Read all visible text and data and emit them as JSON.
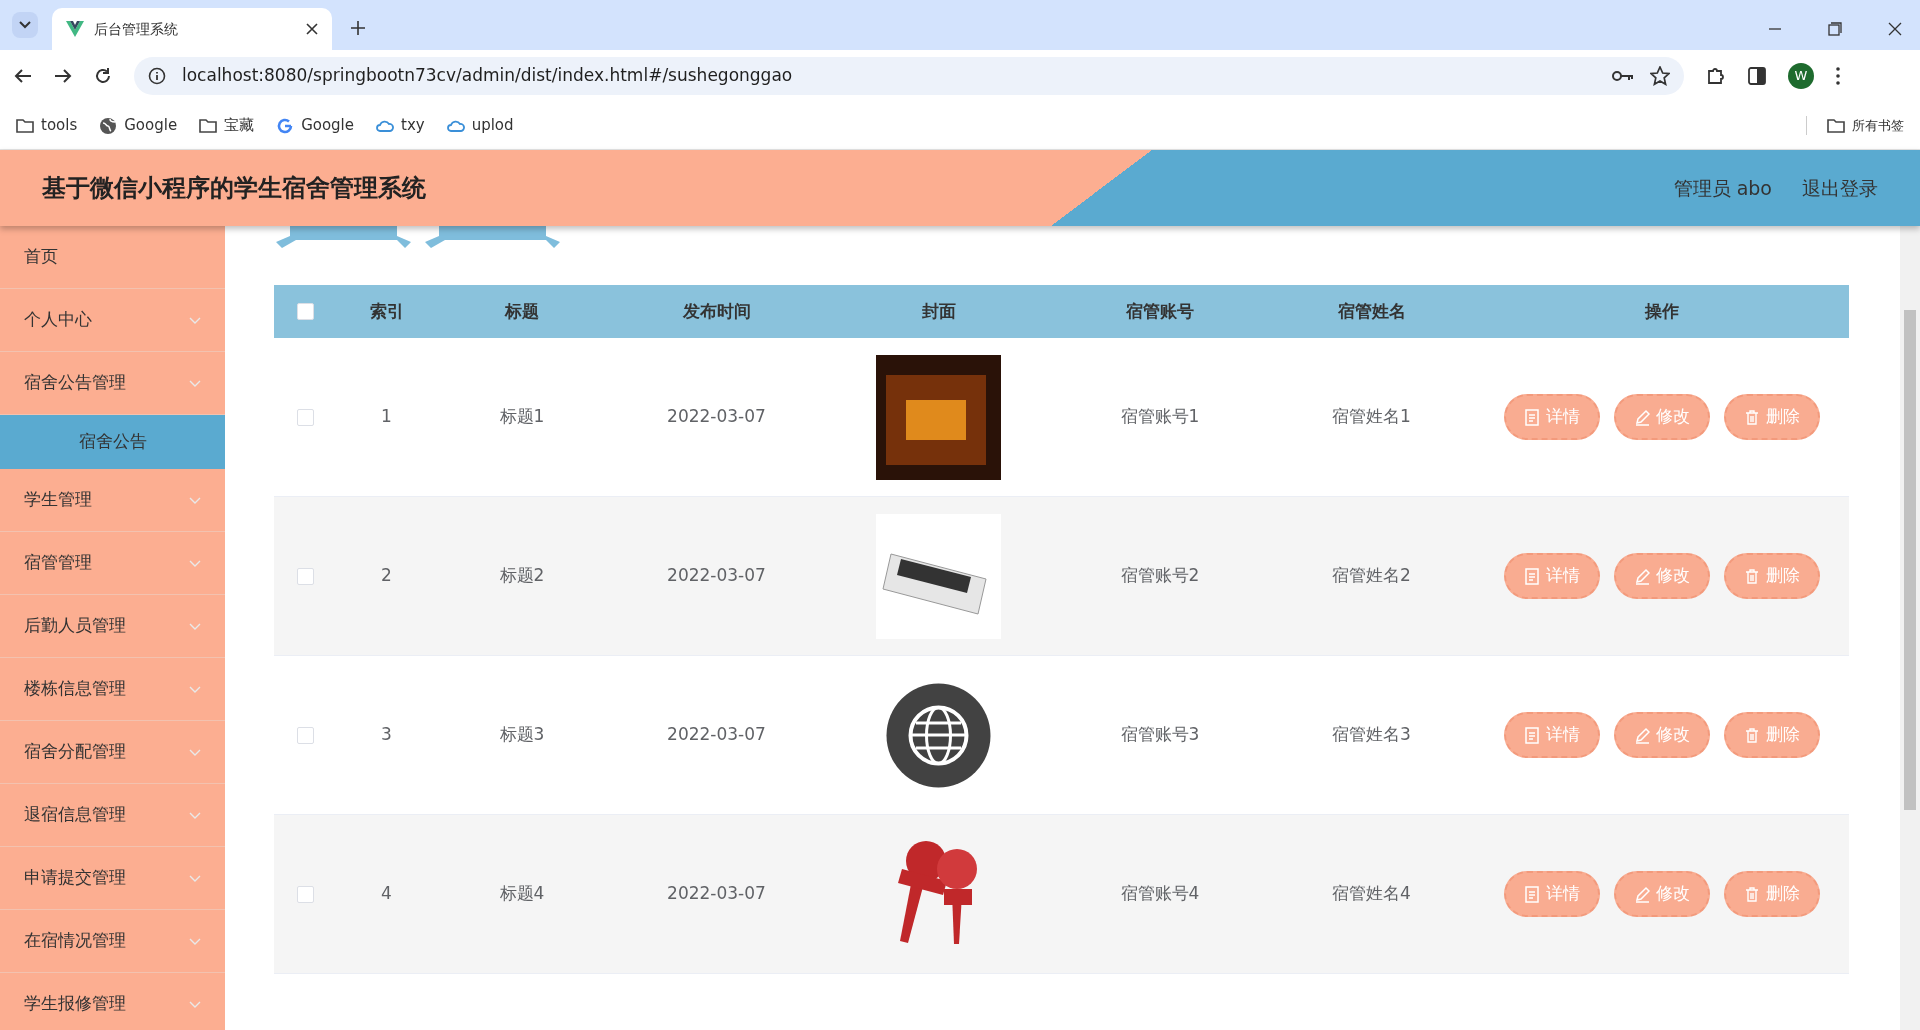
{
  "browser": {
    "tabs": [
      {
        "title": "后台管理系统",
        "selected": true
      }
    ],
    "url": "localhost:8080/springbootn73cv/admin/dist/index.html#/sushegonggao",
    "profile_initial": "W",
    "bookmarks": [
      {
        "kind": "folder",
        "label": "tools"
      },
      {
        "kind": "globe",
        "label": "Google"
      },
      {
        "kind": "folder",
        "label": "宝藏"
      },
      {
        "kind": "google",
        "label": "Google"
      },
      {
        "kind": "cloud",
        "label": "txy"
      },
      {
        "kind": "cloud",
        "label": "uplod"
      }
    ],
    "all_bookmarks": "所有书签"
  },
  "header": {
    "title": "基于微信小程序的学生宿舍管理系统",
    "user": "管理员 abo",
    "logout": "退出登录"
  },
  "sidebar": {
    "items": [
      {
        "label": "首页",
        "has_submenu": false
      },
      {
        "label": "个人中心",
        "has_submenu": true
      },
      {
        "label": "宿舍公告管理",
        "has_submenu": true,
        "children": [
          {
            "label": "宿舍公告",
            "selected": true
          }
        ]
      },
      {
        "label": "学生管理",
        "has_submenu": true
      },
      {
        "label": "宿管管理",
        "has_submenu": true
      },
      {
        "label": "后勤人员管理",
        "has_submenu": true
      },
      {
        "label": "楼栋信息管理",
        "has_submenu": true
      },
      {
        "label": "宿舍分配管理",
        "has_submenu": true
      },
      {
        "label": "退宿信息管理",
        "has_submenu": true
      },
      {
        "label": "申请提交管理",
        "has_submenu": true
      },
      {
        "label": "在宿情况管理",
        "has_submenu": true
      },
      {
        "label": "学生报修管理",
        "has_submenu": true
      }
    ]
  },
  "table": {
    "select_all_checked": false,
    "columns": [
      "索引",
      "标题",
      "发布时间",
      "封面",
      "宿管账号",
      "宿管姓名",
      "操作"
    ],
    "rows": [
      {
        "checked": false,
        "index": "1",
        "title": "标题1",
        "date": "2022-03-07",
        "cover": {
          "kind": "photo"
        },
        "account": "宿管账号1",
        "name": "宿管姓名1",
        "actions": [
          {
            "kind": "detail",
            "label": "详情"
          },
          {
            "kind": "edit",
            "label": "修改"
          },
          {
            "kind": "delete",
            "label": "删除"
          }
        ]
      },
      {
        "checked": false,
        "index": "2",
        "title": "标题2",
        "date": "2022-03-07",
        "cover": {
          "kind": "newspaper"
        },
        "account": "宿管账号2",
        "name": "宿管姓名2",
        "actions": [
          {
            "kind": "detail",
            "label": "详情"
          },
          {
            "kind": "edit",
            "label": "修改"
          },
          {
            "kind": "delete",
            "label": "删除"
          }
        ]
      },
      {
        "checked": false,
        "index": "3",
        "title": "标题3",
        "date": "2022-03-07",
        "cover": {
          "kind": "globe"
        },
        "account": "宿管账号3",
        "name": "宿管姓名3",
        "actions": [
          {
            "kind": "detail",
            "label": "详情"
          },
          {
            "kind": "edit",
            "label": "修改"
          },
          {
            "kind": "delete",
            "label": "删除"
          }
        ]
      },
      {
        "checked": false,
        "index": "4",
        "title": "标题4",
        "date": "2022-03-07",
        "cover": {
          "kind": "microphones"
        },
        "account": "宿管账号4",
        "name": "宿管姓名4",
        "actions": [
          {
            "kind": "detail",
            "label": "详情"
          },
          {
            "kind": "edit",
            "label": "修改"
          },
          {
            "kind": "delete",
            "label": "删除"
          }
        ]
      }
    ]
  }
}
